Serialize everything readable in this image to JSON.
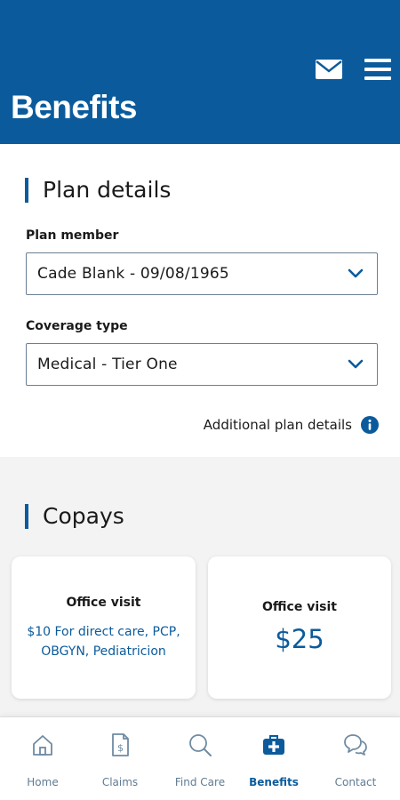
{
  "header": {
    "title": "Benefits",
    "mail_icon": "mail-icon",
    "menu_icon": "hamburger-menu-icon",
    "background_color": "#0b5b9c"
  },
  "plan_details": {
    "heading": "Plan details",
    "plan_member_label": "Plan member",
    "plan_member_value": "Cade Blank - 09/08/1965",
    "coverage_type_label": "Coverage type",
    "coverage_type_value": "Medical - Tier One",
    "additional_link": "Additional plan details",
    "info_icon": "info-icon"
  },
  "copays": {
    "heading": "Copays",
    "cards": [
      {
        "title": "Office visit",
        "description": "$10 For direct care, PCP, OBGYN, Pediatricion"
      },
      {
        "title": "Office visit",
        "amount": "$25"
      }
    ]
  },
  "tabbar": {
    "active": "Benefits",
    "tabs": [
      {
        "label": "Home",
        "icon": "home-icon"
      },
      {
        "label": "Claims",
        "icon": "claims-icon"
      },
      {
        "label": "Find Care",
        "icon": "search-icon"
      },
      {
        "label": "Benefits",
        "icon": "medical-kit-icon"
      },
      {
        "label": "Contact",
        "icon": "chat-bubbles-icon"
      }
    ]
  },
  "colors": {
    "brand": "#0b5b9c",
    "tab_inactive": "#5f7b93",
    "section_gray": "#f3f3f3"
  }
}
